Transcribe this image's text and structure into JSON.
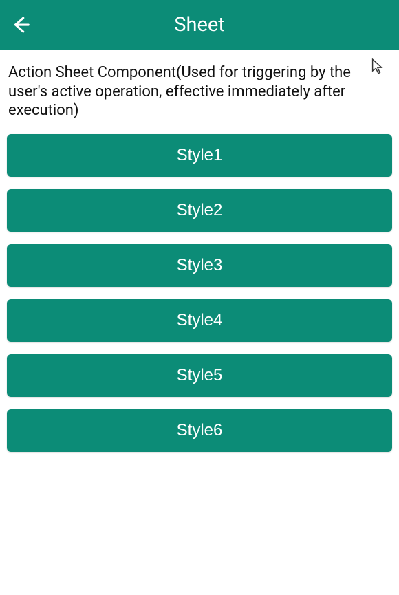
{
  "header": {
    "title": "Sheet"
  },
  "description": "Action Sheet Component(Used for triggering by the user's active operation, effective immediately after execution)",
  "buttons": [
    "Style1",
    "Style2",
    "Style3",
    "Style4",
    "Style5",
    "Style6"
  ],
  "colors": {
    "primary": "#0c8c77",
    "text": "#111111",
    "white": "#ffffff"
  }
}
